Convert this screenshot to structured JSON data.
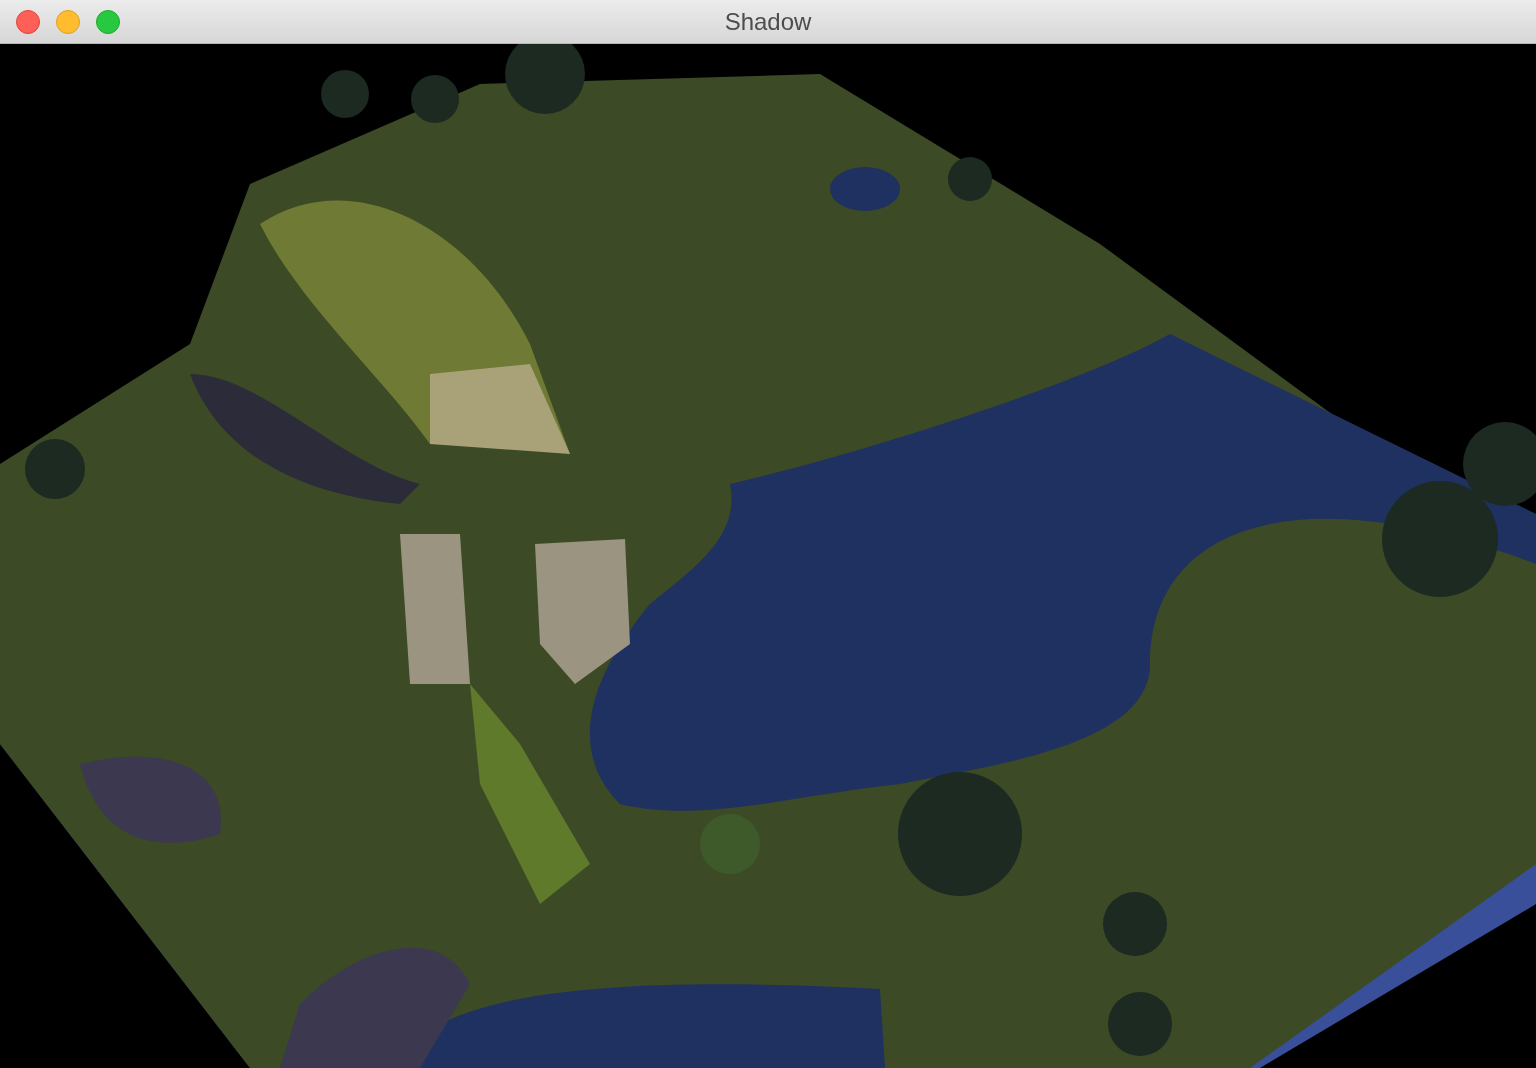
{
  "window": {
    "title": "Shadow"
  }
}
